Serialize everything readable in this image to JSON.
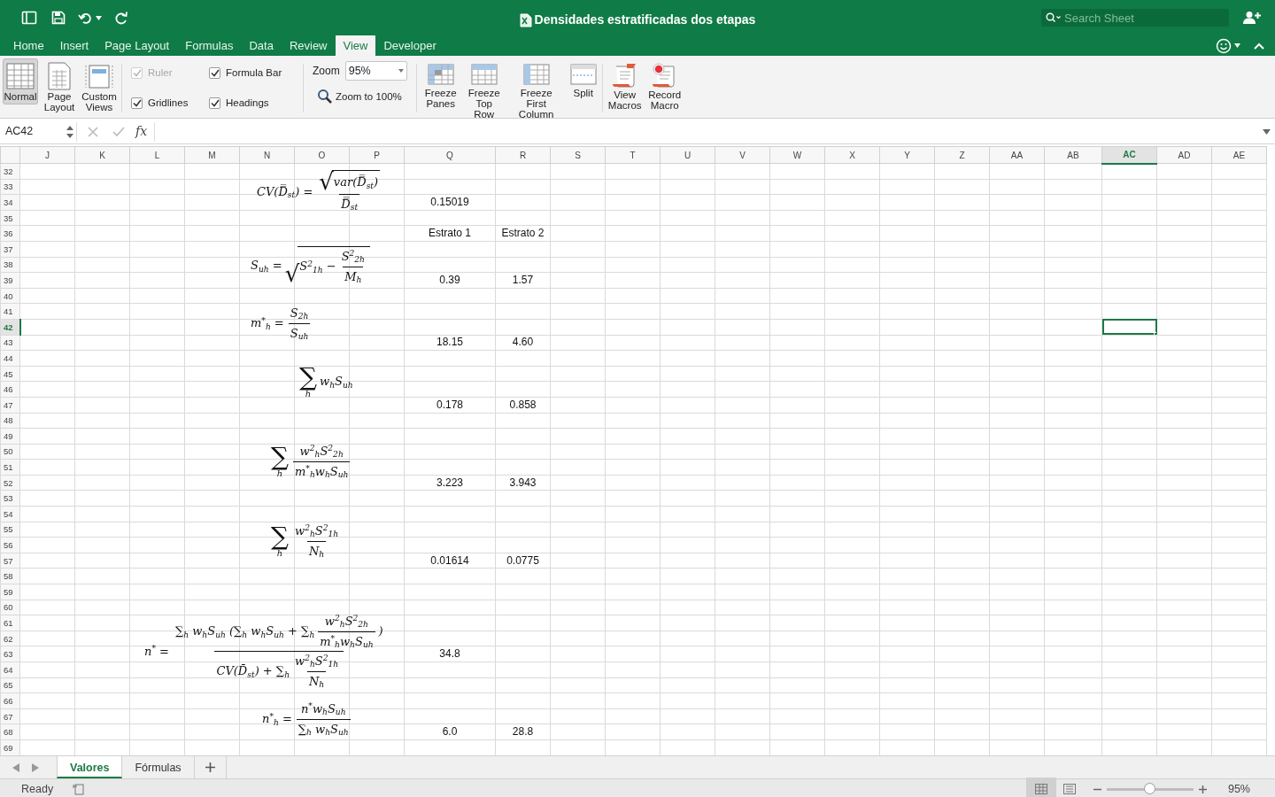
{
  "title_bar": {
    "title": "Densidades estratificadas dos etapas",
    "search": {
      "placeholder": "Search Sheet"
    }
  },
  "ribbon_tabs": [
    {
      "label": "Home",
      "selected": false
    },
    {
      "label": "Insert",
      "selected": false
    },
    {
      "label": "Page Layout",
      "selected": false
    },
    {
      "label": "Formulas",
      "selected": false
    },
    {
      "label": "Data",
      "selected": false
    },
    {
      "label": "Review",
      "selected": false
    },
    {
      "label": "View",
      "selected": true
    },
    {
      "label": "Developer",
      "selected": false
    }
  ],
  "ribbon": {
    "workbook_views": [
      {
        "label": "Normal",
        "selected": true
      },
      {
        "label": "Page Layout",
        "selected": false
      },
      {
        "label": "Custom Views",
        "selected": false
      }
    ],
    "checkboxes": [
      {
        "label": "Ruler",
        "checked": true,
        "disabled": true
      },
      {
        "label": "Formula Bar",
        "checked": true,
        "disabled": false
      },
      {
        "label": "Gridlines",
        "checked": true,
        "disabled": false
      },
      {
        "label": "Headings",
        "checked": true,
        "disabled": false
      }
    ],
    "zoom": {
      "label": "Zoom",
      "value": "95%",
      "reset_button": "Zoom to 100%"
    },
    "window_buttons": [
      "Freeze Panes",
      "Freeze Top Row",
      "Freeze First Column",
      "Split"
    ],
    "macro_buttons": [
      "View Macros",
      "Record Macro"
    ]
  },
  "formula_bar": {
    "name_box": "AC42",
    "function_label": "fx"
  },
  "sheet": {
    "columns": [
      {
        "label": "J",
        "selected": false
      },
      {
        "label": "K",
        "selected": false
      },
      {
        "label": "L",
        "selected": false
      },
      {
        "label": "M",
        "selected": false
      },
      {
        "label": "N",
        "selected": false
      },
      {
        "label": "O",
        "selected": false
      },
      {
        "label": "P",
        "selected": false
      },
      {
        "label": "Q",
        "selected": false
      },
      {
        "label": "R",
        "selected": false
      },
      {
        "label": "S",
        "selected": false
      },
      {
        "label": "T",
        "selected": false
      },
      {
        "label": "U",
        "selected": false
      },
      {
        "label": "V",
        "selected": false
      },
      {
        "label": "W",
        "selected": false
      },
      {
        "label": "X",
        "selected": false
      },
      {
        "label": "Y",
        "selected": false
      },
      {
        "label": "Z",
        "selected": false
      },
      {
        "label": "AA",
        "selected": false
      },
      {
        "label": "AB",
        "selected": false
      },
      {
        "label": "AC",
        "selected": true
      },
      {
        "label": "AD",
        "selected": false
      },
      {
        "label": "AE",
        "selected": false
      }
    ],
    "rows": [
      {
        "number": "32",
        "selected": false
      },
      {
        "number": "33",
        "selected": false
      },
      {
        "number": "34",
        "selected": false,
        "cells": {
          "column_q": "0.15019"
        }
      },
      {
        "number": "35",
        "selected": false
      },
      {
        "number": "36",
        "selected": false,
        "cells": {
          "column_q": "Estrato 1",
          "column_r": "Estrato 2"
        }
      },
      {
        "number": "37",
        "selected": false
      },
      {
        "number": "38",
        "selected": false
      },
      {
        "number": "39",
        "selected": false,
        "cells": {
          "column_q": "0.39",
          "column_r": "1.57"
        }
      },
      {
        "number": "40",
        "selected": false
      },
      {
        "number": "41",
        "selected": false
      },
      {
        "number": "42",
        "selected": true
      },
      {
        "number": "43",
        "selected": false,
        "cells": {
          "column_q": "18.15",
          "column_r": "4.60"
        }
      },
      {
        "number": "44",
        "selected": false
      },
      {
        "number": "45",
        "selected": false
      },
      {
        "number": "46",
        "selected": false
      },
      {
        "number": "47",
        "selected": false,
        "cells": {
          "column_q": "0.178",
          "column_r": "0.858"
        }
      },
      {
        "number": "48",
        "selected": false
      },
      {
        "number": "49",
        "selected": false
      },
      {
        "number": "50",
        "selected": false
      },
      {
        "number": "51",
        "selected": false
      },
      {
        "number": "52",
        "selected": false,
        "cells": {
          "column_q": "3.223",
          "column_r": "3.943"
        }
      },
      {
        "number": "53",
        "selected": false
      },
      {
        "number": "54",
        "selected": false
      },
      {
        "number": "55",
        "selected": false
      },
      {
        "number": "56",
        "selected": false
      },
      {
        "number": "57",
        "selected": false,
        "cells": {
          "column_q": "0.01614",
          "column_r": "0.0775"
        }
      },
      {
        "number": "58",
        "selected": false
      },
      {
        "number": "59",
        "selected": false
      },
      {
        "number": "60",
        "selected": false
      },
      {
        "number": "61",
        "selected": false
      },
      {
        "number": "62",
        "selected": false
      },
      {
        "number": "63",
        "selected": false,
        "cells": {
          "column_q": "34.8"
        }
      },
      {
        "number": "64",
        "selected": false
      },
      {
        "number": "65",
        "selected": false
      },
      {
        "number": "66",
        "selected": false
      },
      {
        "number": "67",
        "selected": false
      },
      {
        "number": "68",
        "selected": false,
        "cells": {
          "column_q": "6.0",
          "column_r": "28.8"
        }
      },
      {
        "number": "69",
        "selected": false
      }
    ],
    "equations": [
      {
        "parts": [
          {
            "kind": "text",
            "text": "CV(D̿$_{st}$) ="
          },
          {
            "kind": "fraction",
            "numerator": [
              {
                "kind": "root",
                "symbol": "√",
                "parts": [
                  {
                    "kind": "text",
                    "text": "var(D̿$_{st}$)"
                  }
                ]
              }
            ],
            "denominator": [
              {
                "kind": "text",
                "text": "D̿$_{st}$"
              }
            ]
          }
        ]
      },
      {
        "parts": [
          {
            "kind": "text",
            "text": "S$_{uh}$ ="
          },
          {
            "kind": "root",
            "symbol": "√",
            "parts": [
              {
                "kind": "text",
                "text": "S$^{2}$$_{1h}$ −"
              },
              {
                "kind": "fraction",
                "numerator": [
                  {
                    "kind": "text",
                    "text": "S$^{2}$$_{2h}$"
                  }
                ],
                "denominator": [
                  {
                    "kind": "text",
                    "text": "M$_{h}$"
                  }
                ]
              }
            ]
          }
        ]
      },
      {
        "parts": [
          {
            "kind": "text",
            "text": "m$^{*}$$_{h}$ ="
          },
          {
            "kind": "fraction",
            "numerator": [
              {
                "kind": "text",
                "text": "S$_{2h}$"
              }
            ],
            "denominator": [
              {
                "kind": "text",
                "text": "S$_{uh}$"
              }
            ]
          }
        ]
      },
      {
        "parts": [
          {
            "kind": "sum",
            "symbol": "∑",
            "index": "h"
          },
          {
            "kind": "text",
            "text": "w$_{h}$S$_{uh}$"
          }
        ]
      },
      {
        "parts": [
          {
            "kind": "sum",
            "symbol": "∑",
            "index": "h"
          },
          {
            "kind": "fraction",
            "numerator": [
              {
                "kind": "text",
                "text": "w$^{2}$$_{h}$S$^{2}$$_{2h}$"
              }
            ],
            "denominator": [
              {
                "kind": "text",
                "text": "m$^{*}$$_{h}$w$_{h}$S$_{uh}$"
              }
            ]
          }
        ]
      },
      {
        "parts": [
          {
            "kind": "sum",
            "symbol": "∑",
            "index": "h"
          },
          {
            "kind": "fraction",
            "numerator": [
              {
                "kind": "text",
                "text": "w$^{2}$$_{h}$S$^{2}$$_{1h}$"
              }
            ],
            "denominator": [
              {
                "kind": "text",
                "text": "N$_{h}$"
              }
            ]
          }
        ]
      },
      {
        "parts": [
          {
            "kind": "text",
            "text": "n$^{*}$ ="
          },
          {
            "kind": "fraction",
            "numerator": [
              {
                "kind": "text",
                "text": "∑$_{h}$ w$_{h}$S$_{uh}$ (∑$_{h}$ w$_{h}$S$_{uh}$ + ∑$_{h}$"
              },
              {
                "kind": "fraction",
                "numerator": [
                  {
                    "kind": "text",
                    "text": "w$^{2}$$_{h}$S$^{2}$$_{2h}$"
                  }
                ],
                "denominator": [
                  {
                    "kind": "text",
                    "text": "m$^{*}$$_{h}$w$_{h}$S$_{uh}$"
                  }
                ]
              },
              {
                "kind": "text",
                "text": ")"
              }
            ],
            "denominator": [
              {
                "kind": "text",
                "text": "CV(D̄$_{st}$) + ∑$_{h}$"
              },
              {
                "kind": "fraction",
                "numerator": [
                  {
                    "kind": "text",
                    "text": "w$^{2}$$_{h}$S$^{2}$$_{1h}$"
                  }
                ],
                "denominator": [
                  {
                    "kind": "text",
                    "text": "N$_{h}$"
                  }
                ]
              }
            ]
          }
        ]
      },
      {
        "parts": [
          {
            "kind": "text",
            "text": "n$^{*}$$_{h}$ ="
          },
          {
            "kind": "fraction",
            "numerator": [
              {
                "kind": "text",
                "text": "n$^{*}$w$_{h}$S$_{uh}$"
              }
            ],
            "denominator": [
              {
                "kind": "text",
                "text": "∑$_{h}$ w$_{h}$S$_{uh}$"
              }
            ]
          }
        ]
      }
    ]
  },
  "sheet_tabs": [
    {
      "label": "Valores",
      "selected": true
    },
    {
      "label": "Fórmulas",
      "selected": false
    }
  ],
  "status_bar": {
    "status": "Ready",
    "zoom_slider": {
      "level": 0.49
    },
    "zoom": "95%"
  }
}
